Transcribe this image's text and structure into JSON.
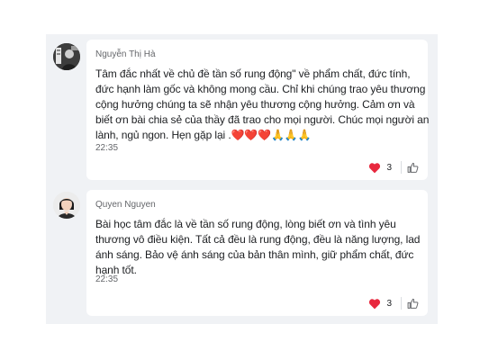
{
  "comments": [
    {
      "author": "Nguyễn Thị Hà",
      "text_lines": [
        "Tâm đắc nhất về chủ đề tần số rung động\"  về phẩm chất, đức tính,",
        "đức hạnh làm gốc và không mong cầu. Chỉ khi chúng trao yêu thương",
        "cộng hưởng chúng ta sẽ nhận yêu thương cộng hưởng. Cảm ơn và",
        "biết ơn bài chia sẻ của thầy đã trao cho mọi người. Chúc mọi người an",
        "lành, ngủ ngon. Hẹn gặp lại .❤️❤️❤️🙏🙏🙏"
      ],
      "time": "22:35",
      "reaction_icon": "heart-icon",
      "reaction_count": "3",
      "like_icon": "thumbs-up-icon"
    },
    {
      "author": "Quyen Nguyen",
      "text_lines": [
        "Bài học tâm đắc là về tần số rung động, lòng biết ơn và tình yêu",
        "thương vô điều kiện. Tất cả đều là rung động, đều là năng lượng, lad",
        "ánh sáng. Bảo vệ ánh sáng của bản thân mình, giữ phẩm chất, đức",
        "hạnh tốt."
      ],
      "time": "22:35",
      "reaction_icon": "heart-icon",
      "reaction_count": "3",
      "like_icon": "thumbs-up-icon"
    }
  ],
  "colors": {
    "panel_bg": "#f0f2f5",
    "bubble_bg": "#ffffff",
    "heart": "#e8283e",
    "meta_text": "#65676b"
  }
}
